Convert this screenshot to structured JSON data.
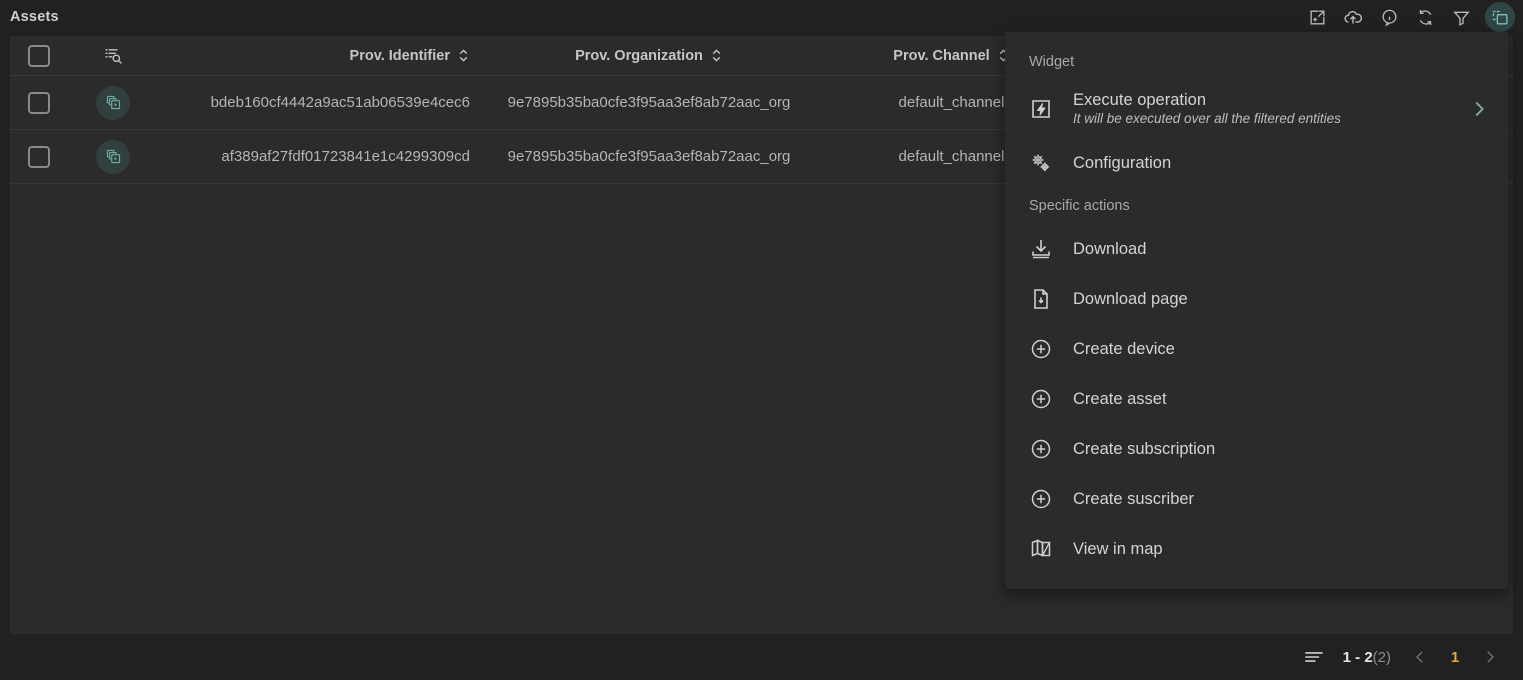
{
  "header": {
    "title": "Assets",
    "icons": [
      {
        "name": "export-window-icon",
        "label": "Export"
      },
      {
        "name": "cloud-upload-icon",
        "label": "Upload"
      },
      {
        "name": "info-icon",
        "label": "Information"
      },
      {
        "name": "refresh-icon",
        "label": "Refresh"
      },
      {
        "name": "filter-icon",
        "label": "Filter"
      },
      {
        "name": "widget-menu-icon",
        "label": "Widget menu"
      }
    ]
  },
  "table": {
    "search_icon": "list-search-icon",
    "columns": [
      {
        "label": "Prov. Identifier",
        "sort_icon": "sort-icon"
      },
      {
        "label": "Prov. Organization",
        "sort_icon": "sort-icon"
      },
      {
        "label": "Prov. Channel",
        "sort_icon": "sort-icon"
      }
    ],
    "rows": [
      {
        "identifier": "bdeb160cf4442a9ac51ab06539e4cec6",
        "organization": "9e7895b35ba0cfe3f95aa3ef8ab72aac_org",
        "channel": "default_channel"
      },
      {
        "identifier": "af389af27fdf01723841e1c4299309cd",
        "organization": "9e7895b35ba0cfe3f95aa3ef8ab72aac_org",
        "channel": "default_channel"
      }
    ]
  },
  "footer": {
    "range": "1 - 2",
    "total": "(2)",
    "current_page": "1"
  },
  "panel": {
    "section_widget": "Widget",
    "section_specific": "Specific actions",
    "items": [
      {
        "label": "Execute operation",
        "sub": "It will be executed over all the filtered entities",
        "icon": "execute-operation-icon",
        "chevron": true
      },
      {
        "label": "Configuration",
        "sub": "",
        "icon": "gears-icon",
        "chevron": false
      },
      {
        "label": "Download",
        "sub": "",
        "icon": "download-icon",
        "chevron": false
      },
      {
        "label": "Download page",
        "sub": "",
        "icon": "download-page-icon",
        "chevron": false
      },
      {
        "label": "Create device",
        "sub": "",
        "icon": "plus-circle-icon",
        "chevron": false
      },
      {
        "label": "Create asset",
        "sub": "",
        "icon": "plus-circle-icon",
        "chevron": false
      },
      {
        "label": "Create subscription",
        "sub": "",
        "icon": "plus-circle-icon",
        "chevron": false
      },
      {
        "label": "Create suscriber",
        "sub": "",
        "icon": "plus-circle-icon",
        "chevron": false
      },
      {
        "label": "View in map",
        "sub": "",
        "icon": "map-icon",
        "chevron": false
      }
    ]
  },
  "colors": {
    "page_bg": "#212121",
    "surface": "#2b2b2b",
    "teal_accent": "#6fada6",
    "amber_accent": "#e8a33d",
    "text_primary": "#d4d4d4",
    "text_secondary": "#a9a9a9"
  }
}
